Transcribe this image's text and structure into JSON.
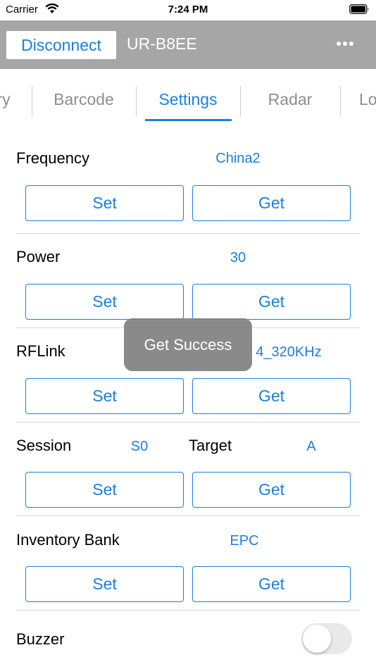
{
  "status_bar": {
    "carrier": "Carrier",
    "time": "7:24 PM",
    "wifi_icon": "wifi-icon",
    "battery_icon": "battery-icon"
  },
  "nav": {
    "disconnect_label": "Disconnect",
    "device_name": "UR-B8EE",
    "more_icon": "more-icon"
  },
  "tabs": [
    {
      "label": "ry",
      "active": false
    },
    {
      "label": "Barcode",
      "active": false
    },
    {
      "label": "Settings",
      "active": true
    },
    {
      "label": "Radar",
      "active": false
    },
    {
      "label": "Lo",
      "active": false
    }
  ],
  "settings": {
    "frequency": {
      "label": "Frequency",
      "value": "China2",
      "set_label": "Set",
      "get_label": "Get"
    },
    "power": {
      "label": "Power",
      "value": "30",
      "set_label": "Set",
      "get_label": "Get"
    },
    "rflink": {
      "label": "RFLink",
      "value": "4_320KHz",
      "set_label": "Set",
      "get_label": "Get"
    },
    "session": {
      "label": "Session",
      "value": "S0",
      "target_label": "Target",
      "target_value": "A",
      "set_label": "Set",
      "get_label": "Get"
    },
    "inventory_bank": {
      "label": "Inventory Bank",
      "value": "EPC",
      "set_label": "Set",
      "get_label": "Get"
    },
    "buzzer": {
      "label": "Buzzer",
      "enabled": false
    }
  },
  "toast": {
    "message": "Get Success"
  },
  "colors": {
    "accent": "#1a7fe0",
    "nav_bg": "#a6a6a6",
    "toast_bg": "#808080"
  }
}
